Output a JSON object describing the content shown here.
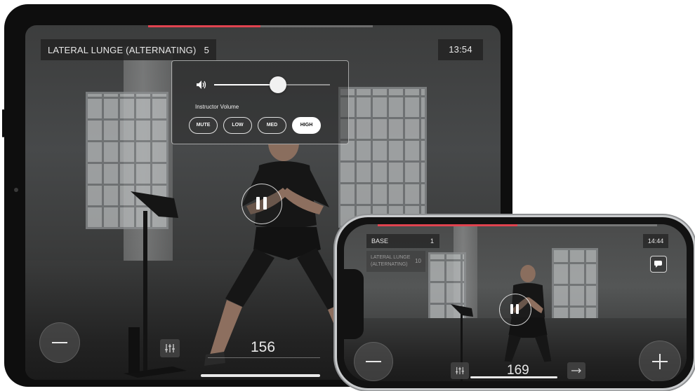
{
  "tablet": {
    "exercise_name": "LATERAL LUNGE (ALTERNATING)",
    "exercise_count": "5",
    "timer": "13:54",
    "volume_panel": {
      "label": "Instructor Volume",
      "level": 0.55,
      "options": [
        "MUTE",
        "LOW",
        "MED",
        "HIGH"
      ],
      "selected": "HIGH"
    },
    "progress": 0.5,
    "metric_value": "156",
    "icons": [
      "speaker-icon",
      "pause-icon",
      "minus-icon",
      "equalizer-icon"
    ]
  },
  "phone": {
    "section_name": "BASE",
    "section_count": "1",
    "next_exercise": "LATERAL LUNGE (ALTERNATING)",
    "next_exercise_line1": "LATERAL LUNGE",
    "next_exercise_line2": "(ALTERNATING)",
    "next_count": "10",
    "timer": "14:44",
    "metric_value": "169",
    "progress": 0.5,
    "icons": [
      "chat-icon",
      "pause-icon",
      "minus-icon",
      "plus-icon",
      "equalizer-icon",
      "arrow-right-icon"
    ]
  },
  "colors": {
    "accent": "#e0434f",
    "hud_bg": "#232323",
    "text": "#e8e8e8"
  }
}
